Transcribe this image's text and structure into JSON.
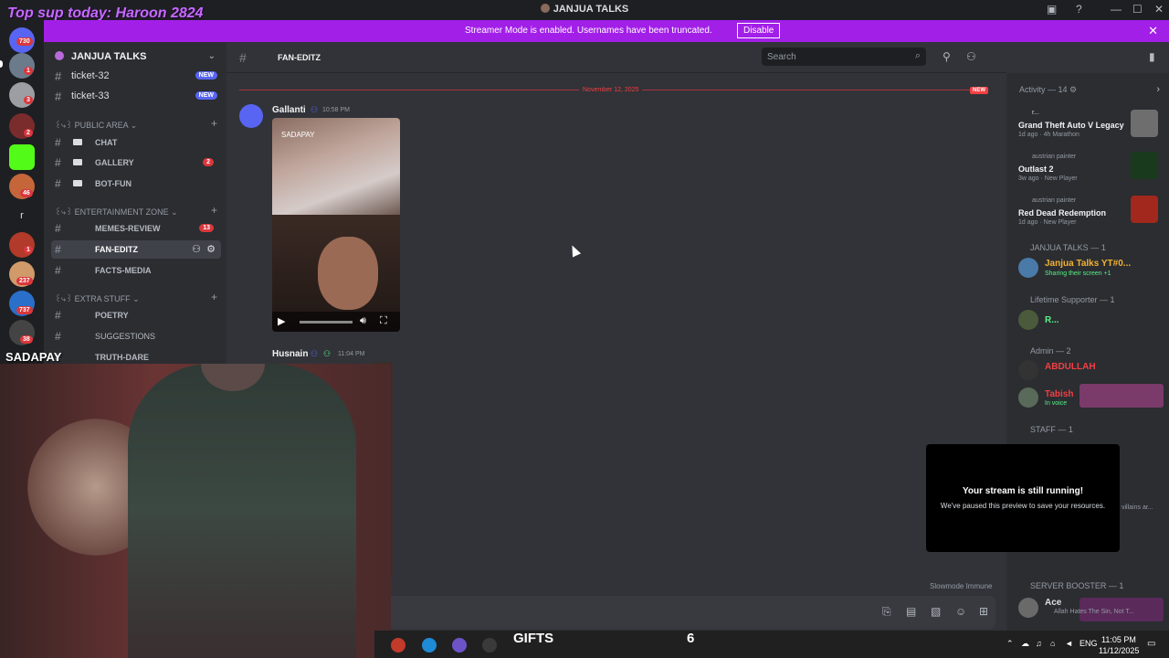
{
  "overlay": {
    "top_text": "Top sup today: Haroon 2824",
    "cam_label": "SADAPAY"
  },
  "window": {
    "title": "JANJUA TALKS",
    "controls": [
      "—",
      "☐",
      "✕"
    ]
  },
  "banner": {
    "message": "Streamer Mode is enabled. Usernames have been truncated.",
    "button": "Disable"
  },
  "rail": {
    "badges": [
      "730",
      "1",
      "3",
      "2",
      "",
      "46",
      "r",
      "1",
      "237",
      "737",
      "38"
    ]
  },
  "sidebar": {
    "server_name": "JANJUA TALKS",
    "tickets": [
      {
        "name": "ticket-32",
        "badge": "NEW"
      },
      {
        "name": "ticket-33",
        "badge": "NEW"
      }
    ],
    "categories": [
      {
        "label": "꒰⤷꒱ PUBLIC AREA ⌄"
      },
      {
        "label": "꒰⤷꒱ ENTERTAINMENT ZONE ⌄"
      },
      {
        "label": "꒰⤷꒱ EXTRA STUFF ⌄"
      }
    ],
    "channels": [
      {
        "name": "CHAT",
        "count": ""
      },
      {
        "name": "GALLERY",
        "count": "2"
      },
      {
        "name": "BOT-FUN",
        "count": ""
      },
      {
        "name": "MEMES-REVIEW",
        "count": "13"
      },
      {
        "name": "FAN-EDITZ",
        "count": ""
      },
      {
        "name": "FACTS-MEDIA",
        "count": ""
      },
      {
        "name": "POETRY",
        "count": ""
      },
      {
        "name": "SUGGESTIONS",
        "count": ""
      },
      {
        "name": "TRUTH-DARE",
        "count": ""
      }
    ]
  },
  "header": {
    "channel": "FAN-EDITZ",
    "search_placeholder": "Search"
  },
  "chat": {
    "date_divider": "November 12, 2025",
    "new_label": "NEW",
    "messages": [
      {
        "author": "Gallanti",
        "time": "10:58 PM",
        "media_watermark": "SADAPAY"
      },
      {
        "author": "Husnain",
        "time": "11:04 PM"
      }
    ],
    "slowmode": "Slowmode Immune"
  },
  "members": {
    "activity_header": "Activity — 14 ⚙",
    "activities": [
      {
        "user": "r...",
        "game": "Grand Theft Auto V Legacy",
        "meta": "1d ago  ·  4h Marathon"
      },
      {
        "user": "austrian painter",
        "game": "Outlast 2",
        "meta": "3w ago  ·  New Player"
      },
      {
        "user": "austrian painter",
        "game": "Red Dead Redemption",
        "meta": "1d ago  ·  New Player"
      }
    ],
    "sections": [
      {
        "title": "JANJUA TALKS — 1"
      },
      {
        "title": "Lifetime Supporter — 1"
      },
      {
        "title": "Admin — 2"
      },
      {
        "title": "STAFF — 1"
      },
      {
        "title": "SERVER BOOSTER — 1"
      }
    ],
    "users": [
      {
        "name": "Janjua Talks YT#0...",
        "sub": "Sharing their screen +1",
        "color": "#f0b232"
      },
      {
        "name": "R...",
        "sub": "",
        "color": "#57f287"
      },
      {
        "name": "ABDULLAH",
        "sub": "",
        "color": "#f23f43"
      },
      {
        "name": "Tabish",
        "sub": "In voice",
        "color": "#f23f43"
      },
      {
        "name": "Ace",
        "sub": "Allah Hates The Sin, Not T...",
        "color": "#dbdee1"
      }
    ],
    "truncated_right": "villains ar..."
  },
  "popup": {
    "title": "Your stream is still running!",
    "body": "We've paused this preview to save your resources."
  },
  "taskbar": {
    "gifts_label": "GIFTS",
    "gifts_count": "6",
    "lang": "ENG",
    "time": "11:05 PM",
    "date": "11/12/2025"
  },
  "colors": {
    "banner": "#a21fe8",
    "accent": "#5865f2",
    "mention": "#da373c"
  }
}
